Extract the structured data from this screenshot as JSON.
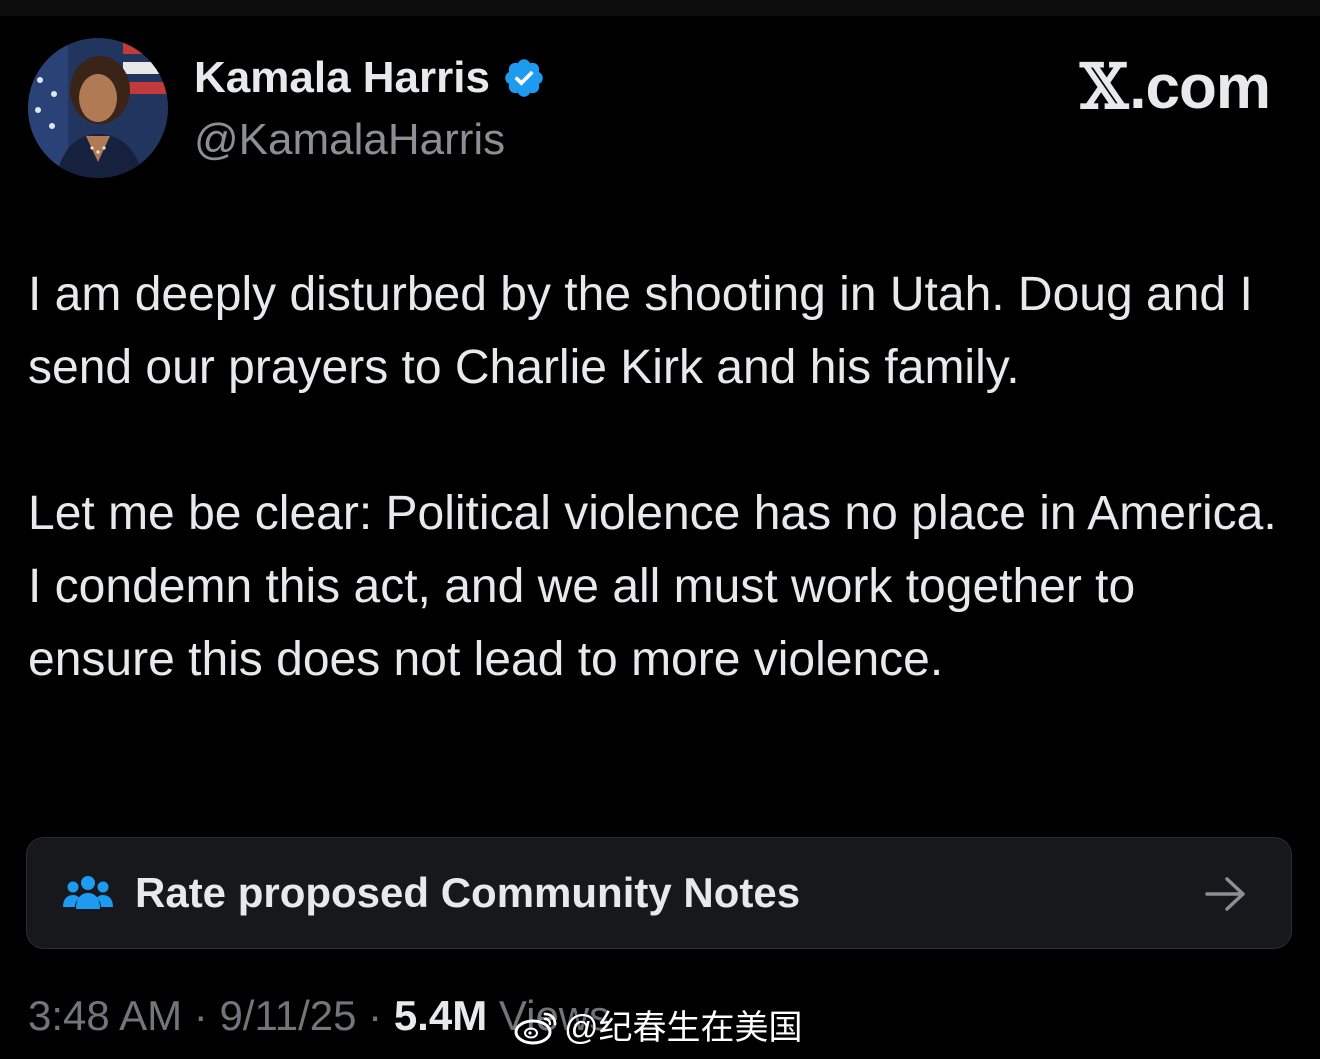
{
  "author": {
    "display_name": "Kamala Harris",
    "handle": "@KamalaHarris",
    "verified": true,
    "avatar_icon": "profile-photo"
  },
  "brand": {
    "label": "X.com",
    "x_glyph": "𝕏",
    "suffix": ".com"
  },
  "tweet": {
    "paragraphs": [
      "I am deeply disturbed by the shooting in Utah. Doug and I send our prayers to Charlie Kirk and his family.",
      "Let me be clear: Political violence has no place in America. I condemn this act, and we all must work together to ensure this does not lead to more violence."
    ]
  },
  "community_notes": {
    "label": "Rate proposed Community Notes",
    "icon": "people-group-icon",
    "arrow_icon": "arrow-right-icon",
    "icon_color": "#1d9bf0"
  },
  "meta": {
    "time": "3:48 AM",
    "separator": "·",
    "date": "9/11/25",
    "views_count": "5.4M",
    "views_label": "Views"
  },
  "watermark": {
    "text": "@纪春生在美国",
    "icon": "weibo-icon"
  },
  "colors": {
    "background": "#000000",
    "text_primary": "#e7e9ea",
    "text_secondary": "#71767b",
    "verified_blue": "#1d9bf0",
    "card_bg": "#16181c"
  }
}
